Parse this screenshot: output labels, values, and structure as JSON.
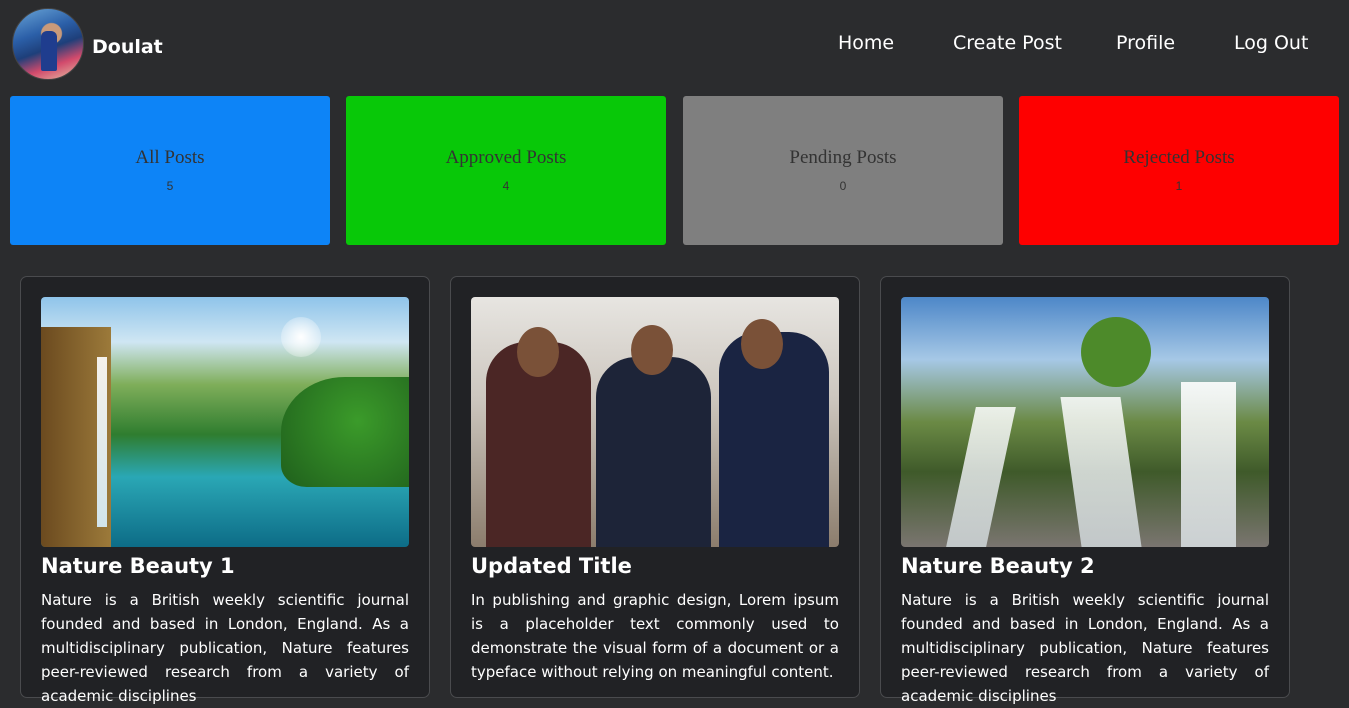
{
  "user": {
    "name": "Doulat"
  },
  "nav": {
    "home": "Home",
    "create_post": "Create Post",
    "profile": "Profile",
    "logout": "Log Out"
  },
  "stats": [
    {
      "label": "All Posts",
      "count": "5",
      "color": "#0d84f7"
    },
    {
      "label": "Approved Posts",
      "count": "4",
      "color": "#08c808"
    },
    {
      "label": "Pending Posts",
      "count": "0",
      "color": "#7f7f7f"
    },
    {
      "label": "Rejected Posts",
      "count": "1",
      "color": "#fe0000"
    }
  ],
  "posts": [
    {
      "title": "Nature Beauty 1",
      "body": "Nature is a British weekly scientific journal founded and based in London, England. As a multidisciplinary publication, Nature features peer-reviewed research from a variety of academic disciplines"
    },
    {
      "title": "Updated Title",
      "body": "In publishing and graphic design, Lorem ipsum is a placeholder text commonly used to demonstrate the visual form of a document or a typeface without relying on meaningful content."
    },
    {
      "title": "Nature Beauty 2",
      "body": "Nature is a British weekly scientific journal founded and based in London, England. As a multidisciplinary publication, Nature features peer-reviewed research from a variety of academic disciplines"
    }
  ]
}
